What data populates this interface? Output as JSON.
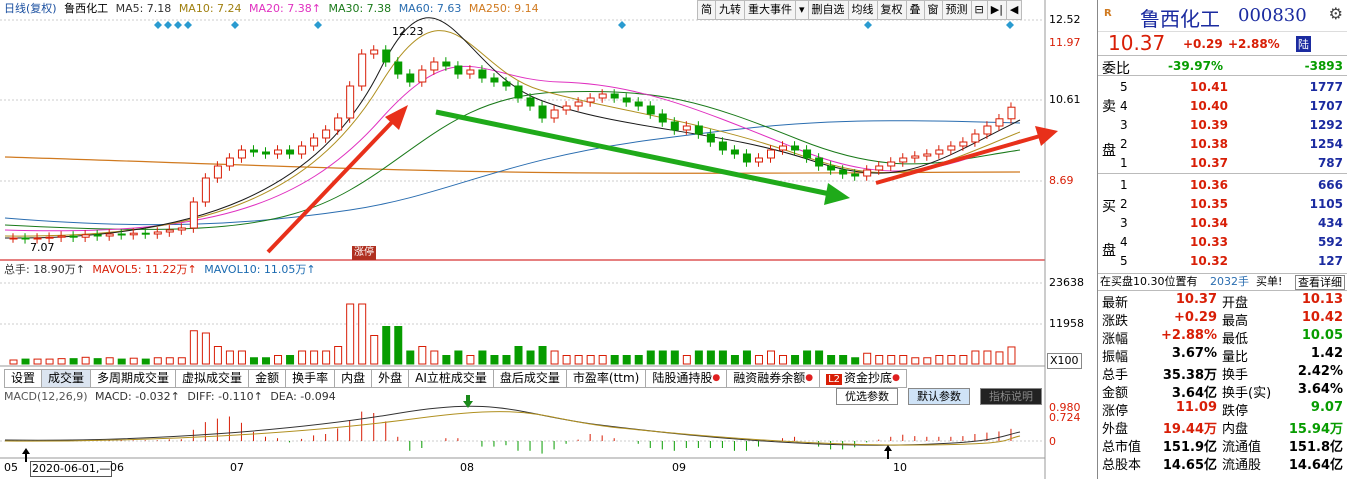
{
  "chart_header": {
    "title": "日线(复权)",
    "name": "鲁西化工",
    "ma5": "MA5: 7.18",
    "ma10": "MA10: 7.24",
    "ma20": "MA20: 7.38↑",
    "ma30": "MA30: 7.38",
    "ma60": "MA60: 7.63",
    "ma250": "MA250: 9.14"
  },
  "toolbar": [
    "简",
    "九转",
    "重大事件",
    "▾",
    "删自选",
    "均线",
    "复权",
    "叠",
    "窗",
    "预测",
    "⊟",
    "▶|",
    "◀"
  ],
  "price_labels": [
    "12.52",
    "11.97",
    "10.61",
    "8.69"
  ],
  "annotations": {
    "high": "12.23",
    "low": "7.07",
    "tag": "涨停"
  },
  "volume_header": {
    "total": "总手: 18.90万↑",
    "mavol5": "MAVOL5: 11.22万↑",
    "mavol10": "MAVOL10: 11.05万↑"
  },
  "volume_labels": [
    "23638",
    "11958",
    "X100"
  ],
  "tabs": [
    "设置",
    "成交量",
    "多周期成交量",
    "虚拟成交量",
    "金额",
    "换手率",
    "内盘",
    "外盘",
    "AI立桩成交量",
    "盘后成交量",
    "市盈率(ttm)",
    "陆股通持股",
    "融资融券余额",
    "资金抄底"
  ],
  "macd_header": {
    "name": "MACD(12,26,9)",
    "macd": "MACD: -0.032↑",
    "diff": "DIFF: -0.110↑",
    "dea": "DEA: -0.094"
  },
  "macd_buttons": [
    "优选参数",
    "默认参数",
    "指标说明"
  ],
  "macd_labels": [
    "0.980",
    "0.724",
    "0"
  ],
  "date_axis": [
    "05",
    "2020-06-01,—",
    "06",
    "07",
    "08",
    "09",
    "10"
  ],
  "chart_data": {
    "type": "candlestick",
    "title": "鲁西化工 000830 日线(复权)",
    "ylim": [
      6.9,
      12.6
    ],
    "high_label": 12.23,
    "low_label": 7.07,
    "closes": [
      7.1,
      7.08,
      7.1,
      7.12,
      7.15,
      7.12,
      7.18,
      7.15,
      7.2,
      7.18,
      7.22,
      7.2,
      7.25,
      7.3,
      7.35,
      8.0,
      8.6,
      8.9,
      9.1,
      9.3,
      9.25,
      9.2,
      9.3,
      9.2,
      9.4,
      9.6,
      9.8,
      10.1,
      10.9,
      11.7,
      11.8,
      11.5,
      11.2,
      11.0,
      11.3,
      11.5,
      11.4,
      11.2,
      11.3,
      11.1,
      11.0,
      10.9,
      10.6,
      10.4,
      10.1,
      10.3,
      10.4,
      10.5,
      10.6,
      10.7,
      10.6,
      10.5,
      10.4,
      10.2,
      10.0,
      9.8,
      9.9,
      9.7,
      9.5,
      9.3,
      9.2,
      9.0,
      9.1,
      9.3,
      9.4,
      9.3,
      9.1,
      8.9,
      8.8,
      8.7,
      8.65,
      8.8,
      8.9,
      9.0,
      9.1,
      9.15,
      9.2,
      9.3,
      9.4,
      9.5,
      9.7,
      9.9,
      10.08,
      10.37
    ]
  },
  "stock": {
    "name": "鲁西化工",
    "code": "000830",
    "price": "10.37",
    "change": "+0.29",
    "pct": "+2.88%",
    "market": "陆"
  },
  "weibi": {
    "label": "委比",
    "pct": "-39.97%",
    "diff": "-3893"
  },
  "sell_side": "卖盘",
  "buy_side": "买盘",
  "asks": [
    [
      "5",
      "10.41",
      "1777"
    ],
    [
      "4",
      "10.40",
      "1707"
    ],
    [
      "3",
      "10.39",
      "1292"
    ],
    [
      "2",
      "10.38",
      "1254"
    ],
    [
      "1",
      "10.37",
      "787"
    ]
  ],
  "bids": [
    [
      "1",
      "10.36",
      "666"
    ],
    [
      "2",
      "10.35",
      "1105"
    ],
    [
      "3",
      "10.34",
      "434"
    ],
    [
      "4",
      "10.33",
      "592"
    ],
    [
      "5",
      "10.32",
      "127"
    ]
  ],
  "notice": {
    "text": "在买盘10.30位置有",
    "qty": "2032手",
    "act": "买单!",
    "link": "查看详细"
  },
  "stats": [
    [
      "最新",
      "10.37",
      "开盘",
      "10.13"
    ],
    [
      "涨跌",
      "+0.29",
      "最高",
      "10.42"
    ],
    [
      "涨幅",
      "+2.88%",
      "最低",
      "10.05"
    ],
    [
      "振幅",
      "3.67%",
      "量比",
      "1.42"
    ],
    [
      "总手",
      "35.38万",
      "换手",
      "2.42%"
    ],
    [
      "金额",
      "3.64亿",
      "换手(实)",
      "3.64%"
    ],
    [
      "涨停",
      "11.09",
      "跌停",
      "9.07"
    ],
    [
      "外盘",
      "19.44万",
      "内盘",
      "15.94万"
    ],
    [
      "总市值",
      "151.9亿",
      "流通值",
      "151.8亿"
    ],
    [
      "总股本",
      "14.65亿",
      "流通股",
      "14.64亿"
    ]
  ]
}
